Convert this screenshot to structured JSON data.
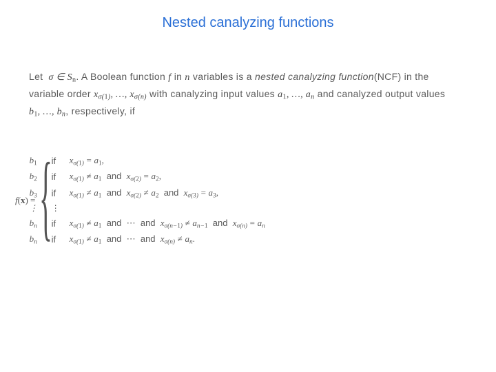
{
  "title": "Nested canalyzing functions",
  "intro": {
    "let": "Let",
    "sigma_in_Sn": "σ ∈ Sₙ",
    "boolfun": ". A Boolean function ",
    "f": "f",
    "in_n": " in ",
    "n": "n",
    "vars_is": " variables is a ",
    "ncf_it": "nested canalyzing function",
    "ncf_abbr": "(NCF) in the variable order ",
    "varorder": "x_{σ(1)}, …, x_{σ(n)}",
    "with": " with canalyzing input values ",
    "inputs": "a₁, …, aₙ",
    "and_out": " and canalyzed output values ",
    "outputs": "b₁, …, bₙ",
    "resp_if": ", respectively, if"
  },
  "lhs": "f(x) =",
  "cases": [
    {
      "out": "b₁",
      "if": "if",
      "cond": "x_{σ(1)} = a₁,",
      "tail": ""
    },
    {
      "out": "b₂",
      "if": "if",
      "cond": "x_{σ(1)} ≠ a₁",
      "tail": " and x_{σ(2)} = a₂,"
    },
    {
      "out": "b₃",
      "if": "if",
      "cond": "x_{σ(1)} ≠ a₁",
      "tail": " and x_{σ(2)} ≠ a₂ and x_{σ(3)} = a₃,"
    },
    {
      "out": "⋮",
      "if": "⋮",
      "cond": "",
      "tail": ""
    },
    {
      "out": "bₙ",
      "if": "if",
      "cond": "x_{σ(1)} ≠ a₁",
      "tail": " and ⋯ and x_{σ(n−1)} ≠ a_{n−1} and x_{σ(n)} = aₙ"
    },
    {
      "out": "bₙ",
      "if": "if",
      "cond": "x_{σ(1)} ≠ a₁",
      "tail": " and ⋯ and x_{σ(n)} ≠ aₙ."
    }
  ]
}
